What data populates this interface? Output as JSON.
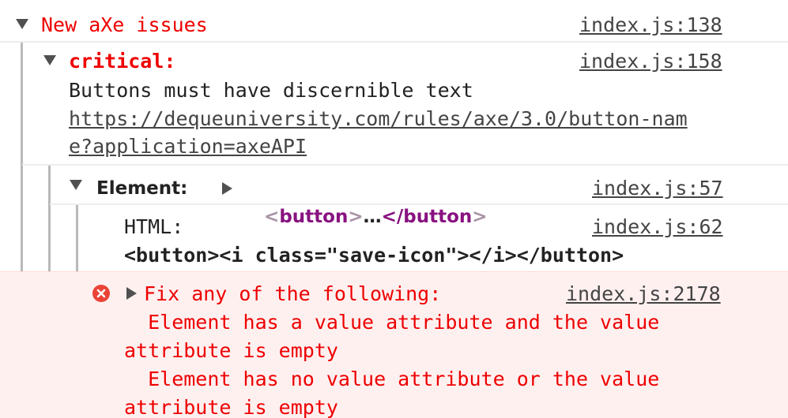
{
  "colors": {
    "error_text": "#ee0000",
    "error_bg": "#fff0f0",
    "error_border": "#ffd6d6",
    "tag_purple": "#881280",
    "bracket_gray": "#a894a6"
  },
  "group": {
    "title": "New aXe issues",
    "source": "index.js:138"
  },
  "critical": {
    "label": "critical:",
    "source": "index.js:158",
    "message": "Buttons must have discernible text",
    "link_line1": "https://dequeuniversity.com/rules/axe/3.0/button-nam",
    "link_line2": "e?application=axeAPI"
  },
  "element": {
    "label": "Element:",
    "tag_open_bracket": "<",
    "tag_name": "button",
    "tag_close_bracket": ">",
    "ellipsis": "…",
    "closing_tag": "</button",
    "closing_bracket": ">",
    "source": "index.js:57"
  },
  "html": {
    "label": "HTML:",
    "source": "index.js:62",
    "code": "<button><i class=\"save-icon\"></i></button>"
  },
  "fix": {
    "icon": "error-icon",
    "title": "Fix any of the following:",
    "source": "index.js:2178",
    "line1": "  Element has a value attribute and the value",
    "line2": "attribute is empty",
    "line3": "  Element has no value attribute or the value",
    "line4": "attribute is empty"
  }
}
